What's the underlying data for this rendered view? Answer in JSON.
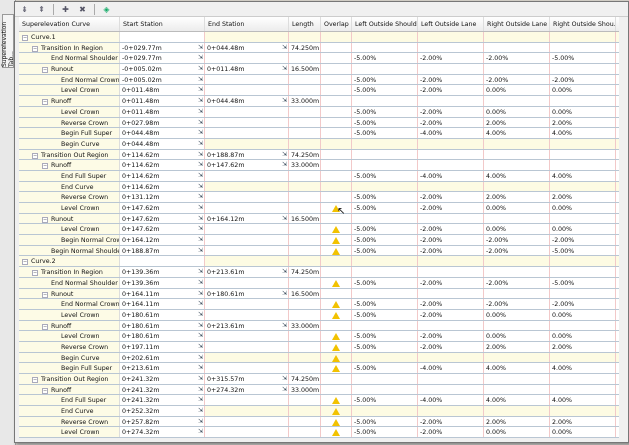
{
  "side_tab": "Superelevation Tab...",
  "toolbar": {
    "icons": [
      "expand-icon",
      "collapse-icon",
      "add-icon",
      "delete-icon",
      "pick-icon"
    ]
  },
  "columns": [
    "Superelevation Curve",
    "Start Station",
    "End Station",
    "Length",
    "Overlap",
    "Left Outside Should...",
    "Left Outside Lane",
    "Right Outside Lane",
    "Right Outside Shou..."
  ],
  "rows": [
    {
      "l": 0,
      "t": "Curve.1",
      "hl": true
    },
    {
      "l": 1,
      "t": "Transition In Region",
      "s": "-0+029.77m",
      "e": "0+044.48m",
      "len": "74.250m"
    },
    {
      "l": 2,
      "t": "End Normal Shoulder",
      "s": "-0+029.77m",
      "v": [
        "-5.00%",
        "-2.00%",
        "-2.00%",
        "-5.00%"
      ]
    },
    {
      "l": 2,
      "t": "Runout",
      "s": "-0+005.02m",
      "e": "0+011.48m",
      "len": "16.500m"
    },
    {
      "l": 3,
      "t": "End Normal Crown",
      "s": "-0+005.02m",
      "v": [
        "-5.00%",
        "-2.00%",
        "-2.00%",
        "-2.00%"
      ]
    },
    {
      "l": 3,
      "t": "Level Crown",
      "s": "0+011.48m",
      "v": [
        "-5.00%",
        "-2.00%",
        "0.00%",
        "0.00%"
      ]
    },
    {
      "l": 2,
      "t": "Runoff",
      "s": "0+011.48m",
      "e": "0+044.48m",
      "len": "33.000m"
    },
    {
      "l": 3,
      "t": "Level Crown",
      "s": "0+011.48m",
      "v": [
        "-5.00%",
        "-2.00%",
        "0.00%",
        "0.00%"
      ]
    },
    {
      "l": 3,
      "t": "Reverse Crown",
      "s": "0+027.98m",
      "v": [
        "-5.00%",
        "-2.00%",
        "2.00%",
        "2.00%"
      ]
    },
    {
      "l": 3,
      "t": "Begin Full Super",
      "s": "0+044.48m",
      "v": [
        "-5.00%",
        "-4.00%",
        "4.00%",
        "4.00%"
      ]
    },
    {
      "l": 3,
      "t": "Begin Curve",
      "s": "0+044.48m",
      "hl": true
    },
    {
      "l": 1,
      "t": "Transition Out Region",
      "s": "0+114.62m",
      "e": "0+188.87m",
      "len": "74.250m"
    },
    {
      "l": 2,
      "t": "Runoff",
      "s": "0+114.62m",
      "e": "0+147.62m",
      "len": "33.000m"
    },
    {
      "l": 3,
      "t": "End Full Super",
      "s": "0+114.62m",
      "v": [
        "-5.00%",
        "-4.00%",
        "4.00%",
        "4.00%"
      ]
    },
    {
      "l": 3,
      "t": "End Curve",
      "s": "0+114.62m",
      "hl": true
    },
    {
      "l": 3,
      "t": "Reverse Crown",
      "s": "0+131.12m",
      "v": [
        "-5.00%",
        "-2.00%",
        "2.00%",
        "2.00%"
      ]
    },
    {
      "l": 3,
      "t": "Level Crown",
      "s": "0+147.62m",
      "w": true,
      "v": [
        "-5.00%",
        "-2.00%",
        "0.00%",
        "0.00%"
      ]
    },
    {
      "l": 2,
      "t": "Runout",
      "s": "0+147.62m",
      "e": "0+164.12m",
      "len": "16.500m"
    },
    {
      "l": 3,
      "t": "Level Crown",
      "s": "0+147.62m",
      "w": true,
      "v": [
        "-5.00%",
        "-2.00%",
        "0.00%",
        "0.00%"
      ]
    },
    {
      "l": 3,
      "t": "Begin Normal Crown",
      "s": "0+164.12m",
      "w": true,
      "v": [
        "-5.00%",
        "-2.00%",
        "-2.00%",
        "-2.00%"
      ]
    },
    {
      "l": 2,
      "t": "Begin Normal Shoulder",
      "s": "0+188.87m",
      "w": true,
      "v": [
        "-5.00%",
        "-2.00%",
        "-2.00%",
        "-5.00%"
      ]
    },
    {
      "l": 0,
      "t": "Curve.2",
      "hl": true
    },
    {
      "l": 1,
      "t": "Transition In Region",
      "s": "0+139.36m",
      "e": "0+213.61m",
      "len": "74.250m"
    },
    {
      "l": 2,
      "t": "End Normal Shoulder",
      "s": "0+139.36m",
      "w": true,
      "v": [
        "-5.00%",
        "-2.00%",
        "-2.00%",
        "-5.00%"
      ]
    },
    {
      "l": 2,
      "t": "Runout",
      "s": "0+164.11m",
      "e": "0+180.61m",
      "len": "16.500m"
    },
    {
      "l": 3,
      "t": "End Normal Crown",
      "s": "0+164.11m",
      "w": true,
      "v": [
        "-5.00%",
        "-2.00%",
        "-2.00%",
        "-2.00%"
      ]
    },
    {
      "l": 3,
      "t": "Level Crown",
      "s": "0+180.61m",
      "w": true,
      "v": [
        "-5.00%",
        "-2.00%",
        "0.00%",
        "0.00%"
      ]
    },
    {
      "l": 2,
      "t": "Runoff",
      "s": "0+180.61m",
      "e": "0+213.61m",
      "len": "33.000m"
    },
    {
      "l": 3,
      "t": "Level Crown",
      "s": "0+180.61m",
      "w": true,
      "v": [
        "-5.00%",
        "-2.00%",
        "0.00%",
        "0.00%"
      ]
    },
    {
      "l": 3,
      "t": "Reverse Crown",
      "s": "0+197.11m",
      "w": true,
      "v": [
        "-5.00%",
        "-2.00%",
        "2.00%",
        "2.00%"
      ]
    },
    {
      "l": 3,
      "t": "Begin Curve",
      "s": "0+202.61m",
      "w": true,
      "hl": true
    },
    {
      "l": 3,
      "t": "Begin Full Super",
      "s": "0+213.61m",
      "w": true,
      "v": [
        "-5.00%",
        "-4.00%",
        "4.00%",
        "4.00%"
      ]
    },
    {
      "l": 1,
      "t": "Transition Out Region",
      "s": "0+241.32m",
      "e": "0+315.57m",
      "len": "74.250m"
    },
    {
      "l": 2,
      "t": "Runoff",
      "s": "0+241.32m",
      "e": "0+274.32m",
      "len": "33.000m"
    },
    {
      "l": 3,
      "t": "End Full Super",
      "s": "0+241.32m",
      "w": true,
      "v": [
        "-5.00%",
        "-4.00%",
        "4.00%",
        "4.00%"
      ]
    },
    {
      "l": 3,
      "t": "End Curve",
      "s": "0+252.32m",
      "w": true,
      "hl": true
    },
    {
      "l": 3,
      "t": "Reverse Crown",
      "s": "0+257.82m",
      "w": true,
      "v": [
        "-5.00%",
        "-2.00%",
        "2.00%",
        "2.00%"
      ]
    },
    {
      "l": 3,
      "t": "Level Crown",
      "s": "0+274.32m",
      "w": true,
      "v": [
        "-5.00%",
        "-2.00%",
        "0.00%",
        "0.00%"
      ]
    }
  ]
}
